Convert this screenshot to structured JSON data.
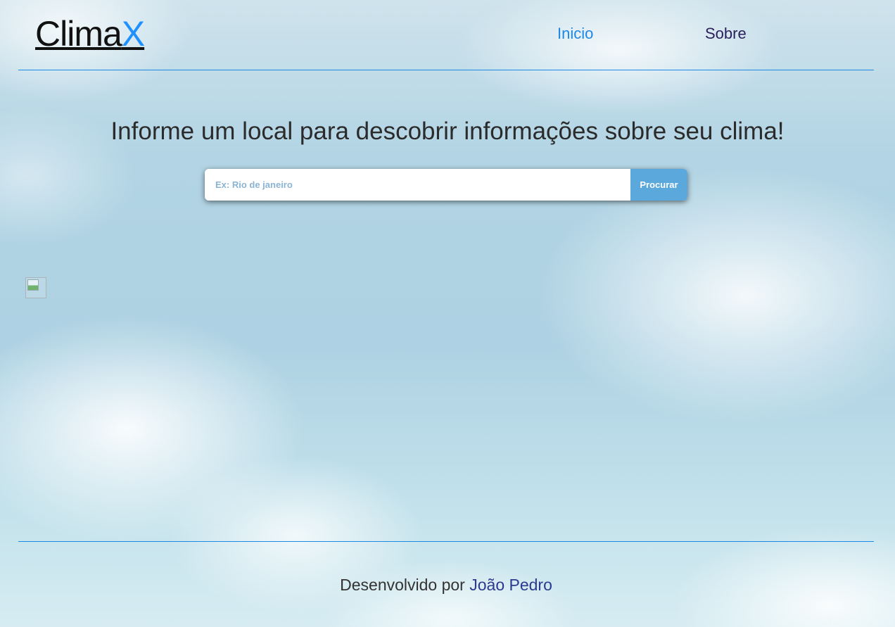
{
  "header": {
    "logo": {
      "main": "Clima",
      "accent": "X"
    },
    "nav": [
      {
        "label": "Inicio"
      },
      {
        "label": "Sobre"
      }
    ]
  },
  "main": {
    "headline": "Informe um local para descobrir informações sobre seu clima!",
    "search": {
      "placeholder": "Ex: Rio de janeiro",
      "value": "",
      "button_label": "Procurar"
    },
    "weather_icon": "broken-image-icon"
  },
  "footer": {
    "prefix": "Desenvolvido por",
    "author": "João Pedro"
  },
  "colors": {
    "accent": "#1e88e5",
    "button": "#5aa8dc",
    "nav_secondary": "#2a1f5c"
  }
}
